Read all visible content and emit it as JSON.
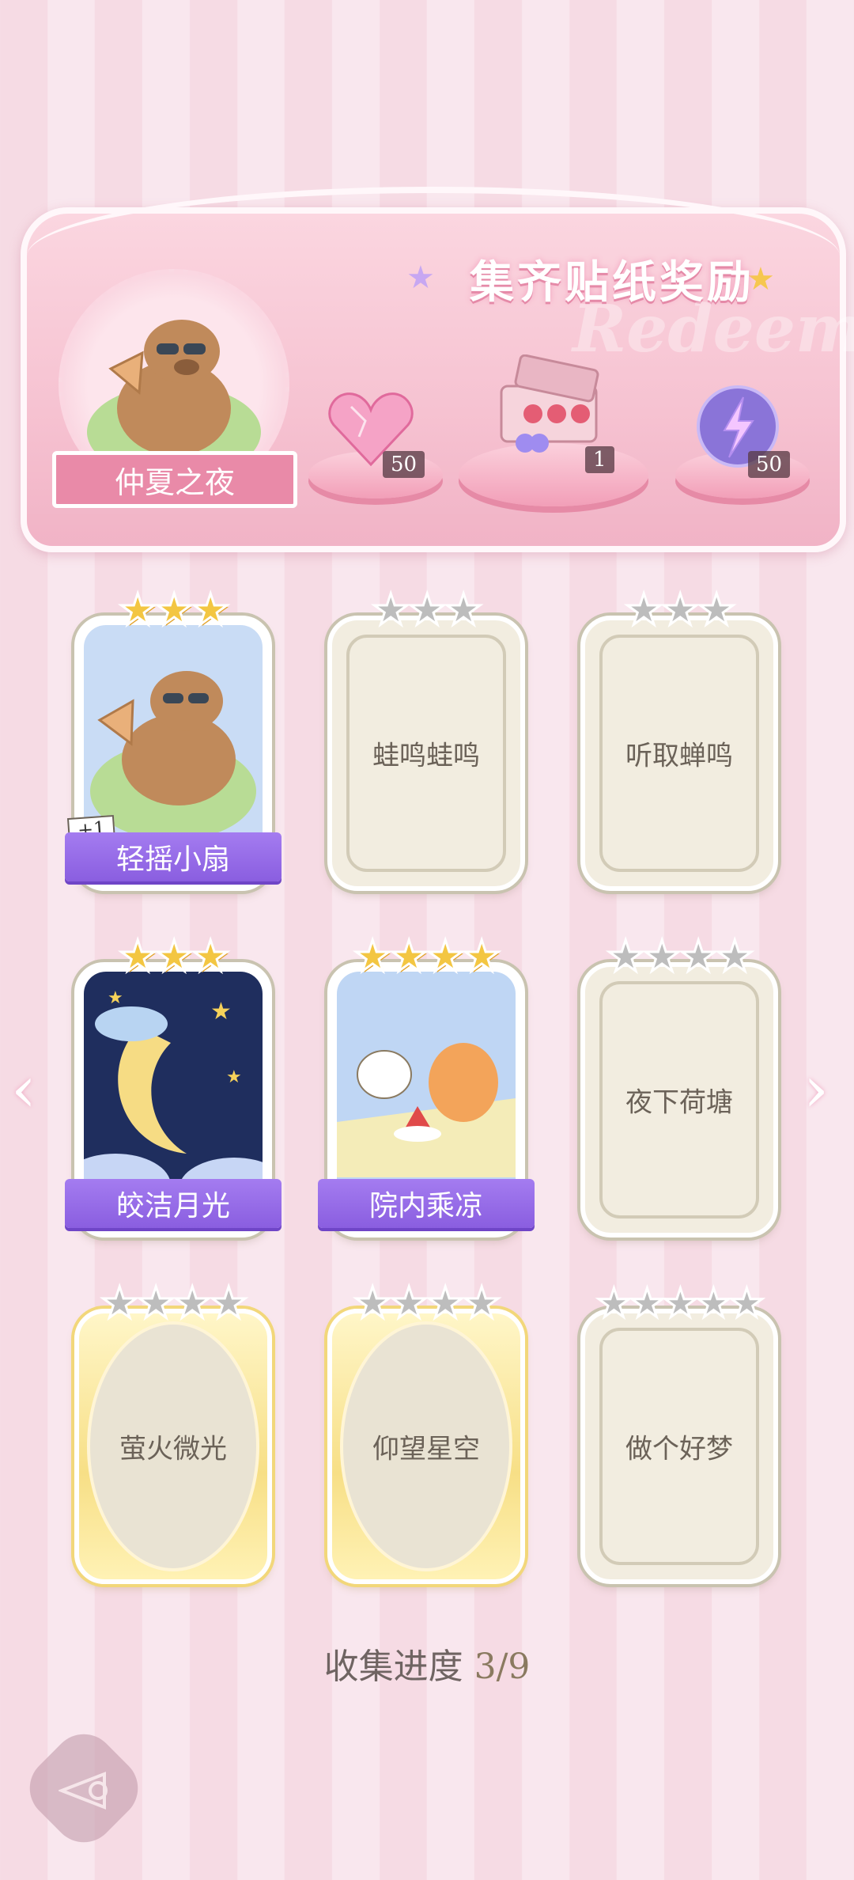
{
  "banner": {
    "title": "集齐贴纸奖励",
    "watermark": "Redeem",
    "event_name": "仲夏之夜",
    "rewards": [
      {
        "icon": "pink-heart-gem-icon",
        "count": "50"
      },
      {
        "icon": "gift-box-icon",
        "count": "1"
      },
      {
        "icon": "lightning-orb-icon",
        "count": "50"
      }
    ]
  },
  "cards": [
    {
      "name": "轻摇小扇",
      "stars_total": 3,
      "stars_filled": 3,
      "collected": true,
      "extra": "+1"
    },
    {
      "name": "蛙鸣蛙鸣",
      "stars_total": 3,
      "stars_filled": 0,
      "collected": false
    },
    {
      "name": "听取蝉鸣",
      "stars_total": 3,
      "stars_filled": 0,
      "collected": false
    },
    {
      "name": "皎洁月光",
      "stars_total": 3,
      "stars_filled": 3,
      "collected": true
    },
    {
      "name": "院内乘凉",
      "stars_total": 4,
      "stars_filled": 4,
      "collected": true
    },
    {
      "name": "夜下荷塘",
      "stars_total": 4,
      "stars_filled": 0,
      "collected": false
    },
    {
      "name": "萤火微光",
      "stars_total": 4,
      "stars_filled": 0,
      "collected": false
    },
    {
      "name": "仰望星空",
      "stars_total": 4,
      "stars_filled": 0,
      "collected": false
    },
    {
      "name": "做个好梦",
      "stars_total": 5,
      "stars_filled": 0,
      "collected": false
    }
  ],
  "progress": {
    "label": "收集进度",
    "value": "3/9"
  },
  "colors": {
    "accent_purple": "#8a5ee0",
    "pink": "#f29fb8",
    "star_gold": "#f3c642"
  }
}
